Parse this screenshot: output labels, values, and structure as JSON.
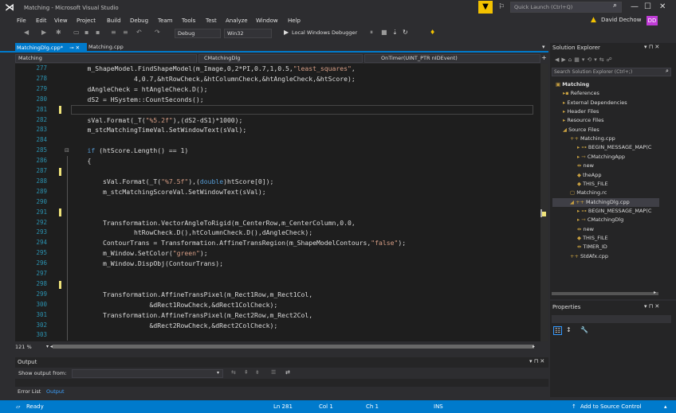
{
  "window": {
    "title": "Matching - Microsoft Visual Studio",
    "quick_launch": "Quick Launch (Ctrl+Q)"
  },
  "menu": [
    "File",
    "Edit",
    "View",
    "Project",
    "Build",
    "Debug",
    "Team",
    "Tools",
    "Test",
    "Analyze",
    "Window",
    "Help"
  ],
  "user": {
    "name": "David Dechow",
    "initials": "DD"
  },
  "toolbar": {
    "config": "Debug",
    "platform": "Win32",
    "run_label": "Local Windows Debugger"
  },
  "tabs": [
    {
      "label": "MatchingDlg.cpp*",
      "active": true
    },
    {
      "label": "Matching.cpp",
      "active": false
    }
  ],
  "nav": {
    "project": "Matching",
    "class": "CMatchingDlg",
    "member": "OnTimer(UINT_PTR nIDEvent)"
  },
  "code": {
    "lines": [
      {
        "n": "277",
        "t": "    m_ShapeModel.FindShapeModel(m_Image,0,2*PI,0.7,1,0.5,\"least_squares\","
      },
      {
        "n": "278",
        "t": "                4,0.7,&htRowCheck,&htColumnCheck,&htAngleCheck,&htScore);"
      },
      {
        "n": "279",
        "t": "    dAngleCheck = htAngleCheck.D();"
      },
      {
        "n": "280",
        "t": "    dS2 = HSystem::CountSeconds();"
      },
      {
        "n": "281",
        "t": ""
      },
      {
        "n": "282",
        "t": "    sVal.Format(_T(\"%5.2f\"),(dS2-dS1)*1000);"
      },
      {
        "n": "283",
        "t": "    m_stcMatchingTimeVal.SetWindowText(sVal);"
      },
      {
        "n": "284",
        "t": ""
      },
      {
        "n": "285",
        "t": "    if (htScore.Length() == 1)"
      },
      {
        "n": "286",
        "t": "    {"
      },
      {
        "n": "287",
        "t": ""
      },
      {
        "n": "288",
        "t": "        sVal.Format(_T(\"%7.5f\"),(double)htScore[0]);"
      },
      {
        "n": "289",
        "t": "        m_stcMatchingScoreVal.SetWindowText(sVal);"
      },
      {
        "n": "290",
        "t": ""
      },
      {
        "n": "291",
        "t": ""
      },
      {
        "n": "292",
        "t": "        Transformation.VectorAngleToRigid(m_CenterRow,m_CenterColumn,0.0,"
      },
      {
        "n": "293",
        "t": "                htRowCheck.D(),htColumnCheck.D(),dAngleCheck);"
      },
      {
        "n": "294",
        "t": "        ContourTrans = Transformation.AffineTransRegion(m_ShapeModelContours,\"false\");"
      },
      {
        "n": "295",
        "t": "        m_Window.SetColor(\"green\");"
      },
      {
        "n": "296",
        "t": "        m_Window.DispObj(ContourTrans);"
      },
      {
        "n": "297",
        "t": ""
      },
      {
        "n": "298",
        "t": ""
      },
      {
        "n": "299",
        "t": "        Transformation.AffineTransPixel(m_Rect1Row,m_Rect1Col,"
      },
      {
        "n": "300",
        "t": "                    &dRect1RowCheck,&dRect1ColCheck);"
      },
      {
        "n": "301",
        "t": "        Transformation.AffineTransPixel(m_Rect2Row,m_Rect2Col,"
      },
      {
        "n": "302",
        "t": "                    &dRect2RowCheck,&dRect2ColCheck);"
      },
      {
        "n": "303",
        "t": ""
      }
    ]
  },
  "zoom": "121 %",
  "output": {
    "title": "Output",
    "show_from": "Show output from:",
    "tab_error": "Error List",
    "tab_output": "Output"
  },
  "solution_explorer": {
    "title": "Solution Explorer",
    "search": "Search Solution Explorer (Ctrl+;)",
    "items": [
      "Matching",
      "References",
      "External Dependencies",
      "Header Files",
      "Resource Files",
      "Source Files",
      "Matching.cpp",
      "BEGIN_MESSAGE_MAP(C",
      "CMatchingApp",
      "new",
      "theApp",
      "THIS_FILE",
      "Matching.rc",
      "MatchingDlg.cpp",
      "BEGIN_MESSAGE_MAP(C",
      "CMatchingDlg",
      "new",
      "THIS_FILE",
      "TIMER_ID",
      "StdAfx.cpp"
    ]
  },
  "properties": {
    "title": "Properties"
  },
  "status": {
    "ready": "Ready",
    "ln": "Ln 281",
    "col": "Col 1",
    "ch": "Ch 1",
    "ins": "INS",
    "source_control": "Add to Source Control"
  }
}
